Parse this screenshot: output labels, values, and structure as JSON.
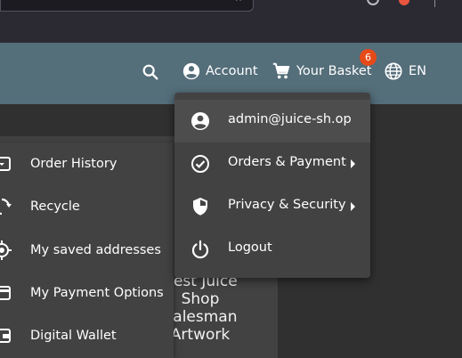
{
  "toolbar": {
    "search_icon": "search-icon",
    "account_label": "Account",
    "basket_label": "Your Basket",
    "basket_count": "6",
    "language_label": "EN"
  },
  "account_menu": {
    "items": [
      {
        "label": "admin@juice-sh.op",
        "icon": "account-circle-icon"
      },
      {
        "label": "Orders & Payment",
        "icon": "check-circle-icon",
        "submenu": true
      },
      {
        "label": "Privacy & Security",
        "icon": "shield-icon",
        "submenu": true
      },
      {
        "label": "Logout",
        "icon": "power-icon"
      }
    ]
  },
  "side_menu": {
    "items": [
      {
        "label": "Order History",
        "icon": "archive-icon"
      },
      {
        "label": "Recycle",
        "icon": "recycle-icon"
      },
      {
        "label": "My saved addresses",
        "icon": "location-icon"
      },
      {
        "label": "My Payment Options",
        "icon": "credit-card-icon"
      },
      {
        "label": "Digital Wallet",
        "icon": "wallet-icon"
      }
    ]
  },
  "artwork": {
    "caption": "Best Juice Shop Salesman Artwork"
  },
  "colors": {
    "toolbar": "#546e7a",
    "menu_bg": "#424242",
    "badge": "#e64a19",
    "page_bg": "#303030"
  }
}
